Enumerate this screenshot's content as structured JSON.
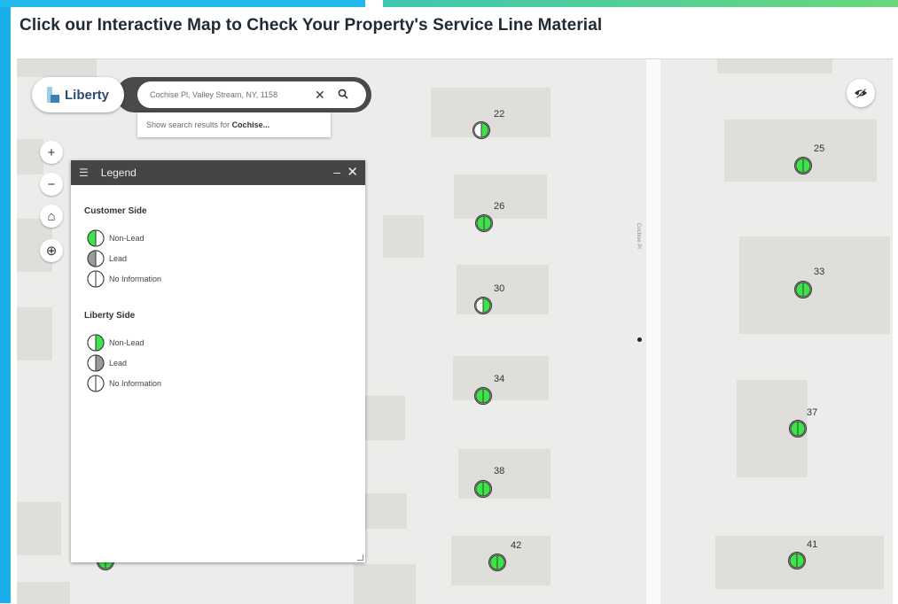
{
  "heading": "Click our Interactive Map to Check Your Property's Service Line Material",
  "app": {
    "brand": "Liberty"
  },
  "search": {
    "value": "Cochise Pl, Valley Stream, NY, 1158",
    "suggestion_prefix": "Show search results for",
    "suggestion_term": "Cochise..."
  },
  "map": {
    "road_label": "Cochise Pl",
    "controls": [
      {
        "name": "zoom-in-button",
        "glyph": "+"
      },
      {
        "name": "zoom-out-button",
        "glyph": "−"
      },
      {
        "name": "home-button",
        "glyph": "⌂"
      },
      {
        "name": "locate-button",
        "glyph": "⊕"
      }
    ],
    "markers": [
      {
        "label": "22",
        "fill": "half"
      },
      {
        "label": "26",
        "fill": "full"
      },
      {
        "label": "30",
        "fill": "half"
      },
      {
        "label": "34",
        "fill": "full"
      },
      {
        "label": "38",
        "fill": "full"
      },
      {
        "label": "42",
        "fill": "full"
      },
      {
        "label": "25",
        "fill": "full"
      },
      {
        "label": "33",
        "fill": "full"
      },
      {
        "label": "37",
        "fill": "full"
      },
      {
        "label": "41",
        "fill": "full"
      },
      {
        "label": "",
        "fill": "full"
      }
    ]
  },
  "legend": {
    "title": "Legend",
    "minimize": "–",
    "close": "✕",
    "sections": [
      {
        "title": "Customer Side",
        "items": [
          {
            "label": "Non-Lead",
            "style": "green-left"
          },
          {
            "label": "Lead",
            "style": "gray-left"
          },
          {
            "label": "No Information",
            "style": "white"
          }
        ]
      },
      {
        "title": "Liberty Side",
        "items": [
          {
            "label": "Non-Lead",
            "style": "green-right"
          },
          {
            "label": "Lead",
            "style": "gray-right"
          },
          {
            "label": "No Information",
            "style": "white"
          }
        ]
      }
    ]
  },
  "colors": {
    "non_lead": "#3ee24a",
    "lead": "#9a9a9a",
    "no_info": "#ffffff",
    "accent_blue": "#19aeea"
  }
}
